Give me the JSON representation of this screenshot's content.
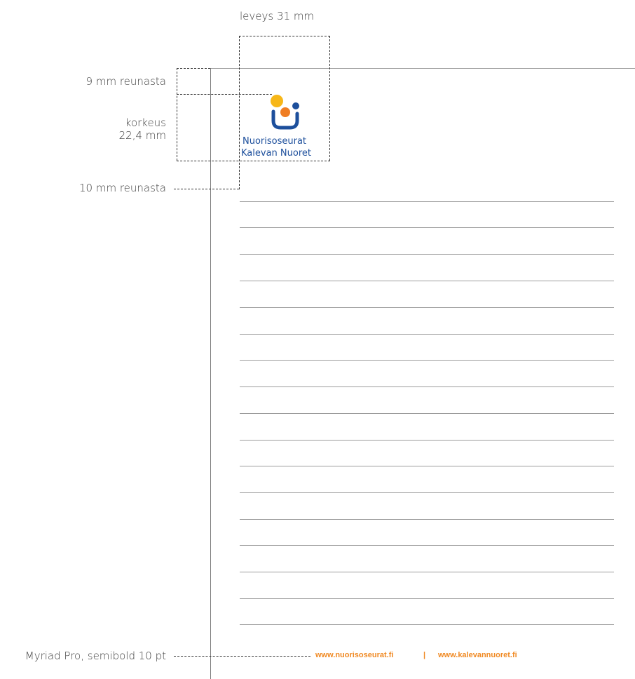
{
  "annotations": {
    "width_label": "leveys 31 mm",
    "top_margin_label": "9 mm reunasta",
    "height_label_line1": "korkeus",
    "height_label_line2": "22,4 mm",
    "left_margin_label": "10 mm reunasta",
    "font_spec_label": "Myriad Pro, semibold 10 pt"
  },
  "logo": {
    "line1": "Nuorisoseurat",
    "line2": "Kalevan Nuoret",
    "colors": {
      "yellow": "#f7b718",
      "orange": "#ef7d22",
      "blue": "#1d4f9c"
    }
  },
  "footer": {
    "link1": "www.nuorisoseurat.fi",
    "separator": "|",
    "link2": "www.kalevannuoret.fi",
    "color": "#f08a24"
  },
  "writing_lines_count": 17
}
